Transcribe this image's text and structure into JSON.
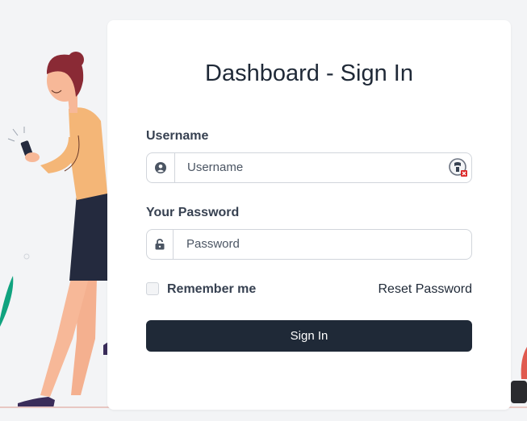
{
  "page": {
    "title": "Dashboard - Sign In"
  },
  "form": {
    "username_label": "Username",
    "username_placeholder": "Username",
    "password_label": "Your Password",
    "password_placeholder": "Password",
    "remember_label": "Remember me",
    "remember_checked": false,
    "reset_link": "Reset Password",
    "submit_label": "Sign In"
  },
  "icons": {
    "username_addon": "user-circle-icon",
    "password_addon": "unlock-icon",
    "extension": "password-manager-extension-icon"
  },
  "colors": {
    "background": "#f3f4f6",
    "card": "#ffffff",
    "primary_button": "#1f2937",
    "border": "#d1d5db"
  }
}
